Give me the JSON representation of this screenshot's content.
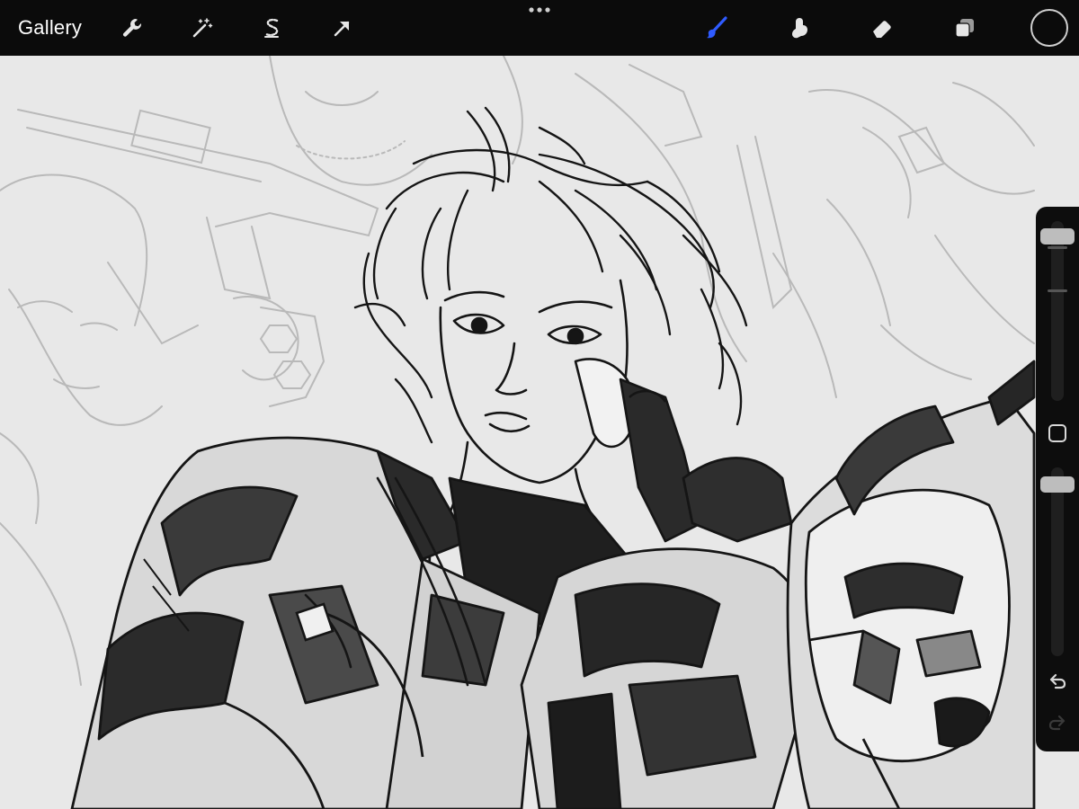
{
  "app": {
    "gallery_label": "Gallery"
  },
  "toolbar": {
    "left_tools": [
      {
        "name": "actions",
        "icon": "wrench-icon"
      },
      {
        "name": "adjustments",
        "icon": "magic-wand-icon"
      },
      {
        "name": "selection",
        "icon": "selection-s-icon"
      },
      {
        "name": "transform",
        "icon": "arrow-cursor-icon"
      }
    ],
    "right_tools": [
      {
        "name": "brush",
        "icon": "brush-icon",
        "active": true
      },
      {
        "name": "smudge",
        "icon": "smudge-finger-icon",
        "active": false
      },
      {
        "name": "eraser",
        "icon": "eraser-icon",
        "active": false
      },
      {
        "name": "layers",
        "icon": "layers-icon",
        "active": false
      }
    ],
    "more_icon": "ellipsis-icon",
    "color_swatch": "#0b0b0b"
  },
  "sidebar": {
    "brush_size": 0.95,
    "opacity": 0.95,
    "undo_icon": "undo-icon",
    "redo_icon": "redo-icon",
    "modify_icon": "square-icon"
  },
  "colors": {
    "toolbar_bg": "#0b0b0b",
    "accent": "#2f5bff",
    "canvas_bg": "#e8e8e8",
    "sketch_gray": "#b9b9b9",
    "ink": "#151515"
  }
}
